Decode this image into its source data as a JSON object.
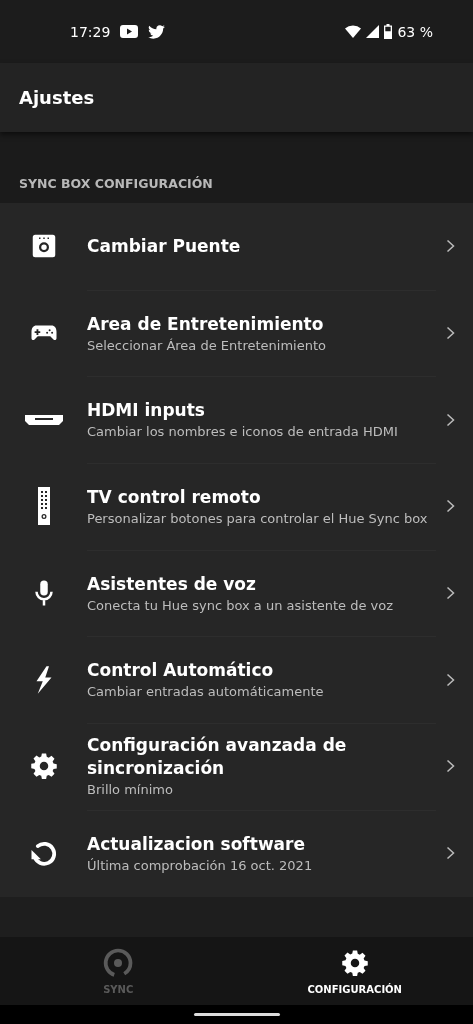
{
  "status_bar": {
    "time": "17:29",
    "battery": "63 %"
  },
  "app_bar": {
    "title": "Ajustes"
  },
  "section": {
    "header": "SYNC BOX CONFIGURACIÓN",
    "items": [
      {
        "kind": "bridge",
        "title": "Cambiar Puente"
      },
      {
        "kind": "gamepad",
        "title": "Area de Entretenimiento",
        "subtitle": "Seleccionar Área de Entretenimiento"
      },
      {
        "kind": "hdmi",
        "title": "HDMI inputs",
        "subtitle": "Cambiar los nombres e iconos de entrada HDMI"
      },
      {
        "kind": "remote",
        "title": "TV control remoto",
        "subtitle": "Personalizar botones para controlar el Hue Sync box"
      },
      {
        "kind": "mic",
        "title": "Asistentes de voz",
        "subtitle": "Conecta tu Hue sync box a un asistente de voz"
      },
      {
        "kind": "bolt",
        "title": "Control Automático",
        "subtitle": "Cambiar entradas automáticamente"
      },
      {
        "kind": "gear",
        "title": "Configuración avanzada de sincronización",
        "subtitle": "Brillo mínimo"
      },
      {
        "kind": "refresh",
        "title": "Actualizacion software",
        "subtitle": "Última comprobación 16 oct. 2021"
      }
    ]
  },
  "bottom_nav": [
    {
      "kind": "sync",
      "label": "SYNC",
      "selected": false
    },
    {
      "kind": "gear",
      "label": "CONFIGURACIÓN",
      "selected": true
    }
  ]
}
